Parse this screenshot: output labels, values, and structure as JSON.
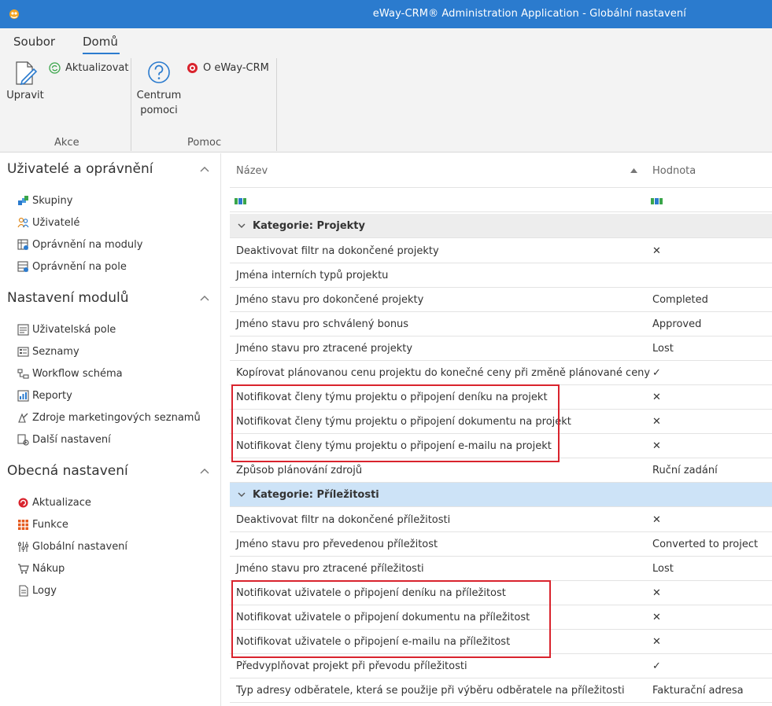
{
  "window": {
    "title": "eWay-CRM® Administration Application - Globální nastavení"
  },
  "ribbon": {
    "tabs": [
      "Soubor",
      "Domů"
    ],
    "upravit_label": "Upravit",
    "aktualizovat_label": "Aktualizovat",
    "centrum_label_1": "Centrum",
    "centrum_label_2": "pomoci",
    "about_label": "O eWay-CRM",
    "group_akce": "Akce",
    "group_pomoc": "Pomoc"
  },
  "sidebar": {
    "sections": [
      {
        "title": "Uživatelé a oprávnění",
        "items": [
          "Skupiny",
          "Uživatelé",
          "Oprávnění na moduly",
          "Oprávnění na pole"
        ]
      },
      {
        "title": "Nastavení modulů",
        "items": [
          "Uživatelská pole",
          "Seznamy",
          "Workflow schéma",
          "Reporty",
          "Zdroje marketingových seznamů",
          "Další nastavení"
        ]
      },
      {
        "title": "Obecná nastavení",
        "items": [
          "Aktualizace",
          "Funkce",
          "Globální nastavení",
          "Nákup",
          "Logy"
        ]
      }
    ]
  },
  "grid": {
    "col_name": "Název",
    "col_value": "Hodnota",
    "categories": [
      {
        "title": "Kategorie: Projekty",
        "rows": [
          {
            "name": "Deaktivovat filtr na dokončené projekty",
            "value": "✕"
          },
          {
            "name": "Jména interních typů projektu",
            "value": ""
          },
          {
            "name": "Jméno stavu pro dokončené projekty",
            "value": "Completed"
          },
          {
            "name": "Jméno stavu pro schválený bonus",
            "value": "Approved"
          },
          {
            "name": "Jméno stavu pro ztracené projekty",
            "value": "Lost"
          },
          {
            "name": "Kopírovat plánovanou cenu projektu do konečné ceny při změně plánované ceny",
            "value": "✓"
          },
          {
            "name": "Notifikovat členy týmu projektu o připojení deníku na projekt",
            "value": "✕"
          },
          {
            "name": "Notifikovat členy týmu projektu o připojení dokumentu na projekt",
            "value": "✕"
          },
          {
            "name": "Notifikovat členy týmu projektu o připojení e-mailu na projekt",
            "value": "✕"
          },
          {
            "name": "Způsob plánování zdrojů",
            "value": "Ruční zadání"
          }
        ]
      },
      {
        "title": "Kategorie: Příležitosti",
        "rows": [
          {
            "name": "Deaktivovat filtr na dokončené příležitosti",
            "value": "✕"
          },
          {
            "name": "Jméno stavu pro převedenou příležitost",
            "value": "Converted to project"
          },
          {
            "name": "Jméno stavu pro ztracené příležitosti",
            "value": "Lost"
          },
          {
            "name": "Notifikovat uživatele o připojení deníku na příležitost",
            "value": "✕"
          },
          {
            "name": "Notifikovat uživatele o připojení dokumentu na příležitost",
            "value": "✕"
          },
          {
            "name": "Notifikovat uživatele o připojení e-mailu na příležitost",
            "value": "✕"
          },
          {
            "name": "Předvyplňovat projekt při převodu příležitosti",
            "value": "✓"
          },
          {
            "name": "Typ adresy odběratele, která se použije při výběru odběratele na příležitosti",
            "value": "Fakturační adresa"
          }
        ]
      }
    ]
  },
  "colors": {
    "accent": "#2b7bce",
    "highlight": "#d9232d",
    "selected_row": "#cde3f7"
  }
}
